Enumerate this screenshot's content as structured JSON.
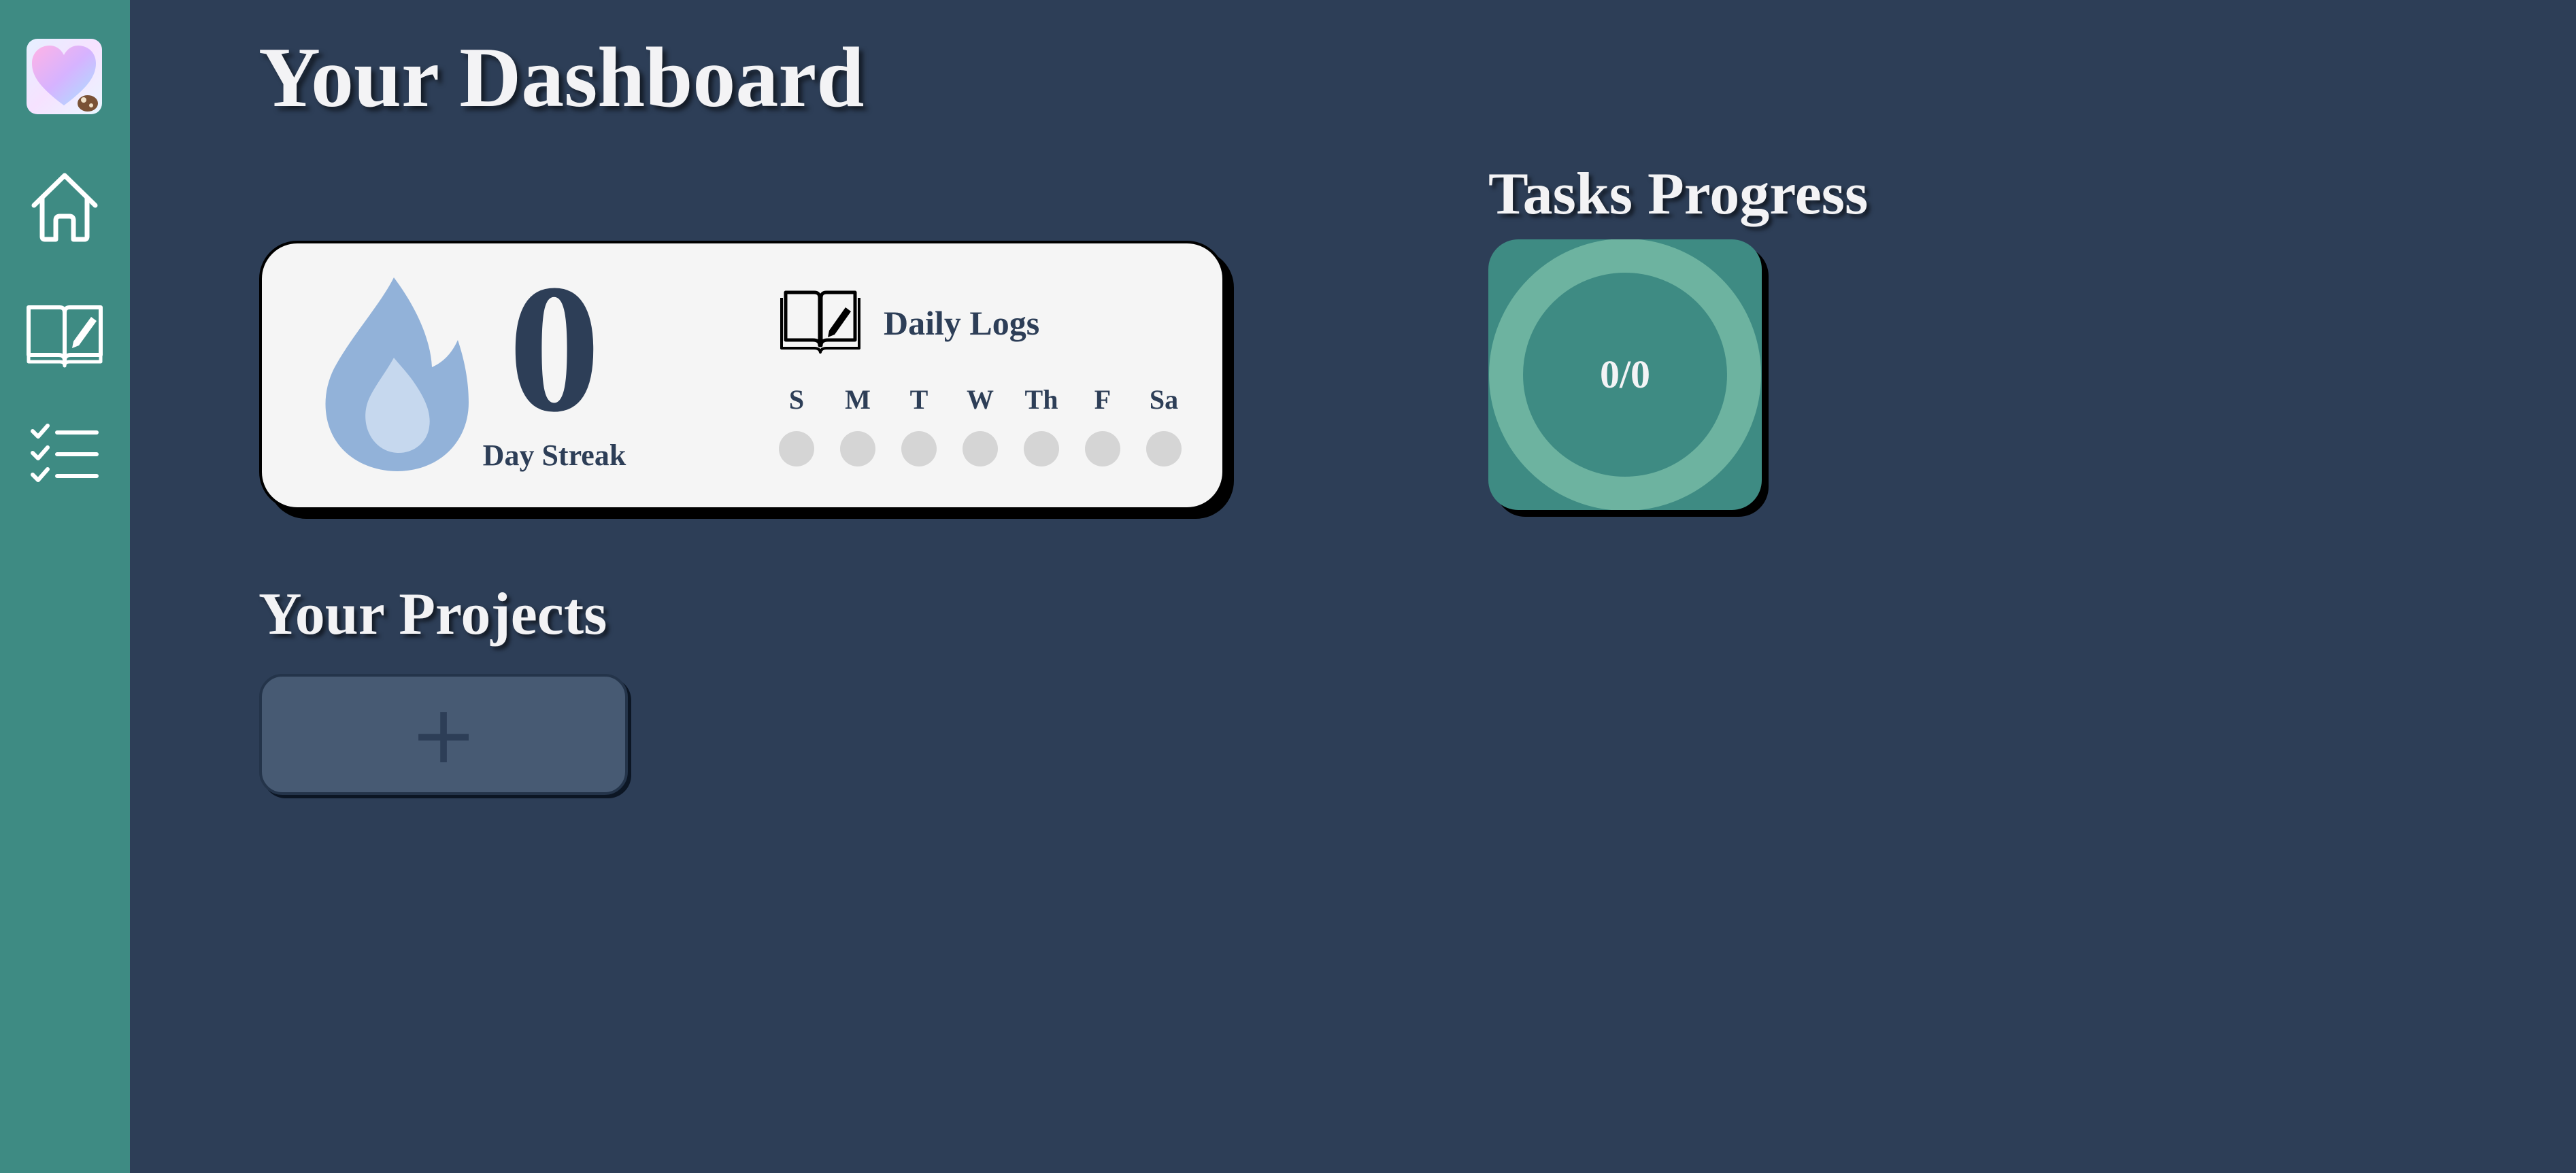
{
  "sidebar": {
    "items": [
      {
        "icon": "home-icon"
      },
      {
        "icon": "journal-icon"
      },
      {
        "icon": "checklist-icon"
      }
    ]
  },
  "dashboard": {
    "title": "Your Dashboard"
  },
  "streak": {
    "value": "0",
    "label": "Day Streak"
  },
  "daily_logs": {
    "title": "Daily Logs",
    "days": [
      "S",
      "M",
      "T",
      "W",
      "Th",
      "F",
      "Sa"
    ],
    "logged": [
      false,
      false,
      false,
      false,
      false,
      false,
      false
    ]
  },
  "tasks_progress": {
    "title": "Tasks Progress",
    "text": "0/0",
    "completed": 0,
    "total": 0
  },
  "projects": {
    "title": "Your Projects",
    "add_label": "+"
  },
  "colors": {
    "background": "#2d3e57",
    "sidebar": "#3e8b83",
    "card": "#f5f5f5",
    "flame": "#92b2d9",
    "progress_ring": "#6db3a0",
    "accent_text": "#2d3e57"
  }
}
